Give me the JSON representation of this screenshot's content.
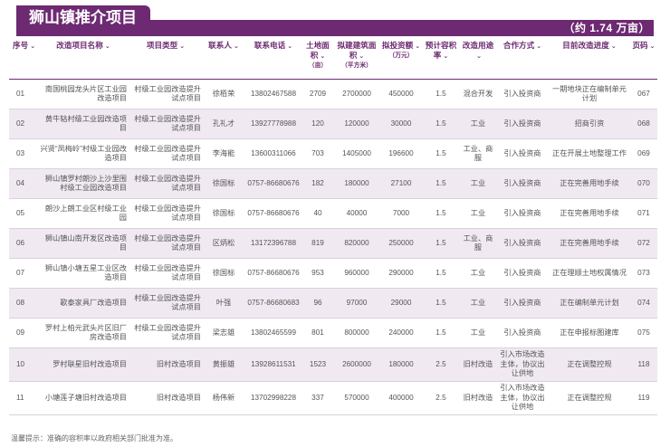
{
  "header": {
    "title": "狮山镇推介项目",
    "area_label": "（约 1.74 万亩）"
  },
  "columns": [
    {
      "label": "序号",
      "sub": ""
    },
    {
      "label": "改造项目名称",
      "sub": ""
    },
    {
      "label": "项目类型",
      "sub": ""
    },
    {
      "label": "联系人",
      "sub": ""
    },
    {
      "label": "联系电话",
      "sub": ""
    },
    {
      "label": "土地面积",
      "sub": "（亩）"
    },
    {
      "label": "拟建建筑面积",
      "sub": "（平方米）"
    },
    {
      "label": "拟投资额",
      "sub": "（万元）"
    },
    {
      "label": "预计容积率",
      "sub": ""
    },
    {
      "label": "改造用途",
      "sub": ""
    },
    {
      "label": "合作方式",
      "sub": ""
    },
    {
      "label": "目前改造进度",
      "sub": ""
    },
    {
      "label": "页码",
      "sub": ""
    }
  ],
  "rows": [
    [
      "01",
      "南国桃园龙头片区工业园改造项目",
      "村级工业园改造提升试点项目",
      "徐栢荣",
      "13802467588",
      "2709",
      "2700000",
      "450000",
      "1.5",
      "混合开发",
      "引入投资商",
      "一期地块正在编制单元计划",
      "067"
    ],
    [
      "02",
      "黄牛轱村级工业园改造项目",
      "村级工业园改造提升试点项目",
      "孔礼才",
      "13927778988",
      "120",
      "120000",
      "30000",
      "1.5",
      "工业",
      "引入投资商",
      "招商引资",
      "068"
    ],
    [
      "03",
      "兴贤“凤梅岭”村级工业园改造项目",
      "村级工业园改造提升试点项目",
      "李海能",
      "13600311066",
      "703",
      "1405000",
      "196600",
      "1.5",
      "工业、商服",
      "引入投资商",
      "正在开展土地整理工作",
      "069"
    ],
    [
      "04",
      "狮山镇罗村朗沙上沙里围村级工业园改造项目",
      "村级工业园改造提升试点项目",
      "徐国标",
      "0757-86680676",
      "182",
      "180000",
      "27100",
      "1.5",
      "工业",
      "引入投资商",
      "正在完善用地手续",
      "070"
    ],
    [
      "05",
      "朗沙上朗工业区村级工业园",
      "村级工业园改造提升试点项目",
      "徐国标",
      "0757-86680676",
      "40",
      "40000",
      "7000",
      "1.5",
      "工业",
      "引入投资商",
      "正在完善用地手续",
      "071"
    ],
    [
      "06",
      "狮山镇山南开发区改造项目",
      "村级工业园改造提升试点项目",
      "区炳松",
      "13172396788",
      "819",
      "820000",
      "250000",
      "1.5",
      "工业、商服",
      "引入投资商",
      "正在完善用地手续",
      "072"
    ],
    [
      "07",
      "狮山镇小塘五星工业区改造项目",
      "村级工业园改造提升试点项目",
      "徐国标",
      "0757-86680676",
      "953",
      "960000",
      "290000",
      "1.5",
      "工业",
      "引入投资商",
      "正在理顺土地权属情况",
      "073"
    ],
    [
      "08",
      "歌泰家具厂改造项目",
      "村级工业园改造提升试点项目",
      "叶强",
      "0757-86680683",
      "96",
      "97000",
      "29000",
      "1.5",
      "工业",
      "引入投资商",
      "正在编制单元计划",
      "074"
    ],
    [
      "09",
      "罗村上柏元武头片区旧厂房改造项目",
      "村级工业园改造提升试点项目",
      "梁志雄",
      "13802465599",
      "801",
      "800000",
      "240000",
      "1.5",
      "工业",
      "引入投资商",
      "正在申报标图建库",
      "075"
    ],
    [
      "10",
      "罗村联星旧村改造项目",
      "旧村改造项目",
      "黄振雄",
      "13928611531",
      "1523",
      "2600000",
      "180000",
      "2.5",
      "旧村改造",
      "引入市场改造主体，协议出让供地",
      "正在调整控规",
      "118"
    ],
    [
      "11",
      "小塘莲子塘旧村改造项目",
      "旧村改造项目",
      "杨伟新",
      "13702998228",
      "337",
      "570000",
      "400000",
      "2.5",
      "旧村改造",
      "引入市场改造主体，协议出让供地",
      "正在调整控规",
      "119"
    ]
  ],
  "footer": {
    "note": "温馨提示：准确的容积率以政府相关部门批准为准。"
  }
}
